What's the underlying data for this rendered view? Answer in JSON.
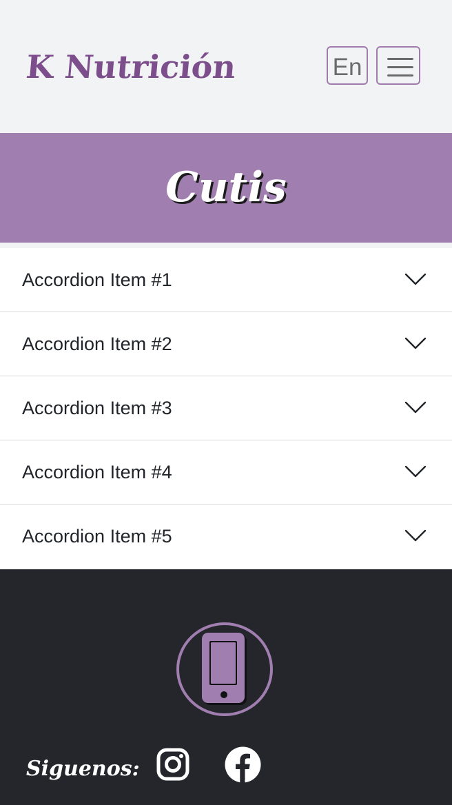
{
  "navbar": {
    "brand": "K Nutrición",
    "lang_button": "En",
    "menu_icon": "hamburger-icon"
  },
  "hero": {
    "title": "Cutis"
  },
  "accordion": {
    "items": [
      {
        "label": "Accordion Item #1",
        "icon": "chevron-down-icon"
      },
      {
        "label": "Accordion Item #2",
        "icon": "chevron-down-icon"
      },
      {
        "label": "Accordion Item #3",
        "icon": "chevron-down-icon"
      },
      {
        "label": "Accordion Item #4",
        "icon": "chevron-down-icon"
      },
      {
        "label": "Accordion Item #5",
        "icon": "chevron-down-icon"
      }
    ]
  },
  "footer": {
    "contact_icon": "phone-icon",
    "follow_label": "Siguenos:",
    "social": [
      {
        "name": "instagram-icon"
      },
      {
        "name": "facebook-icon"
      }
    ]
  },
  "colors": {
    "brand": "#7d4e8c",
    "hero_bg": "#a17eb0",
    "footer_bg": "#24262b",
    "page_bg": "#f2f3f5"
  }
}
